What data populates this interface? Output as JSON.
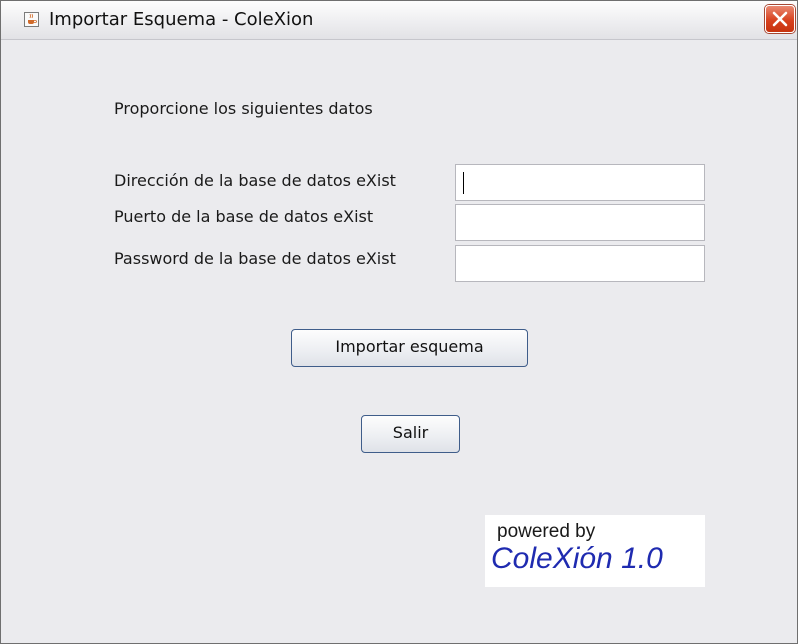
{
  "window": {
    "title": "Importar Esquema - ColeXion"
  },
  "form": {
    "intro": "Proporcione los siguientes datos",
    "fields": [
      {
        "label": "Dirección de la base de datos eXist",
        "value": ""
      },
      {
        "label": "Puerto de la base de datos eXist",
        "value": ""
      },
      {
        "label": "Password de la base de datos eXist",
        "value": ""
      }
    ]
  },
  "buttons": {
    "import_label": "Importar esquema",
    "exit_label": "Salir"
  },
  "logo": {
    "line1": "powered by",
    "line2": "ColeXión 1.0"
  },
  "icons": {
    "app": "java-cup-icon",
    "close": "close-icon"
  },
  "colors": {
    "close_button": "#d8421f",
    "logo_text": "#1f2bb0",
    "window_bg": "#ebebee"
  }
}
